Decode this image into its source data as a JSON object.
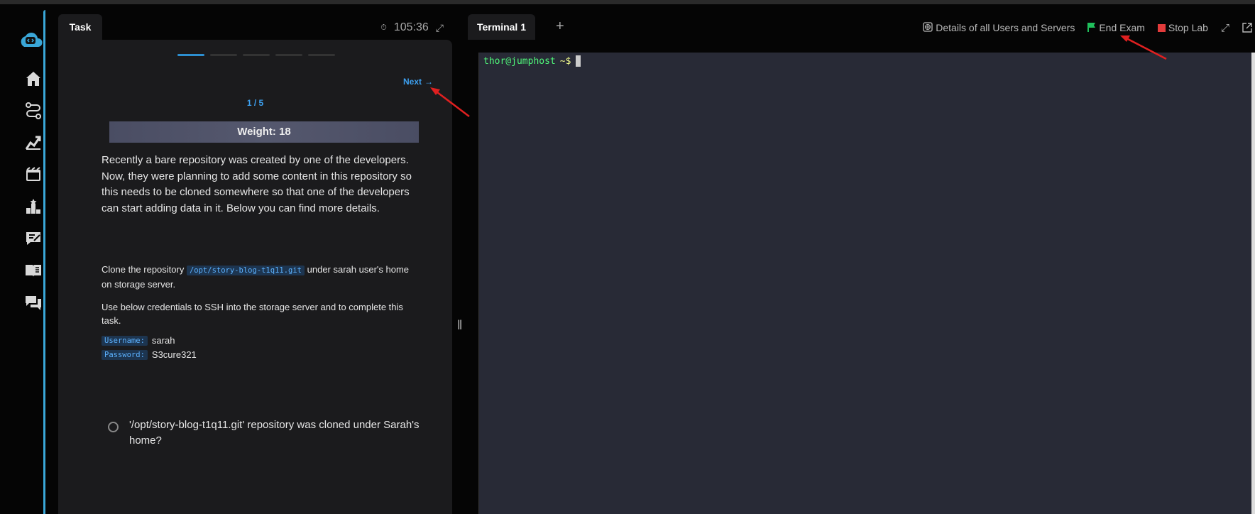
{
  "task": {
    "tab_label": "Task",
    "timer": "105:36",
    "next_label": "Next",
    "counter": "1 / 5",
    "weight": "Weight: 18",
    "description": "Recently a bare repository was created by one of the developers. Now, they were planning to add some content in this repository so this needs to be cloned somewhere so that one of the developers can start adding data in it. Below you can find more details.",
    "clone_pre": "Clone the repository",
    "repo_path": "/opt/story-blog-t1q11.git",
    "clone_post": "under sarah user's home on storage server.",
    "ssh_note": "Use below credentials to SSH into the storage server and to complete this task.",
    "username_label": "Username:",
    "username_value": "sarah",
    "password_label": "Password:",
    "password_value": "S3cure321",
    "question": "'/opt/story-blog-t1q11.git' repository was cloned under Sarah's home?"
  },
  "terminal": {
    "tab_label": "Terminal 1",
    "add_tab": "+",
    "details_label": "Details of all Users and Servers",
    "end_exam_label": "End Exam",
    "stop_lab_label": "Stop Lab",
    "prompt_user": "thor@jumphost",
    "prompt_symbol": "~$"
  },
  "colors": {
    "accent": "#3da0ef",
    "flag": "#20c05c",
    "stop": "#e33b3b",
    "rail_edge": "#3aa7d8",
    "arrow": "#e02020"
  },
  "icons": {
    "rail": [
      "home-icon",
      "route-icon",
      "chart-icon",
      "media-icon",
      "leaderboard-icon",
      "notes-icon",
      "book-icon",
      "chat-icon"
    ]
  }
}
